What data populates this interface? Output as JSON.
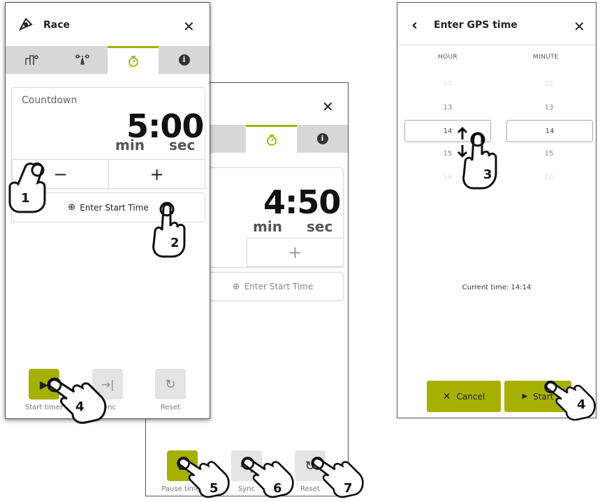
{
  "left_panel": {
    "title": "Race",
    "countdown_label": "Countdown",
    "time": "5:00",
    "unit_min": "min",
    "unit_sec": "sec",
    "minus": "−",
    "plus": "+",
    "enter_start_time": "Enter Start Time",
    "controls": [
      {
        "label": "Start timer",
        "icon": "play-icon",
        "active": true
      },
      {
        "label": "Sync",
        "icon": "sync-icon",
        "active": false
      },
      {
        "label": "Reset",
        "icon": "reset-icon",
        "active": false
      }
    ]
  },
  "middle_panel": {
    "time": "4:50",
    "unit_min": "min",
    "unit_sec": "sec",
    "plus": "+",
    "enter_start_time": "Enter Start Time",
    "controls": [
      {
        "label": "Pause timer",
        "icon": "pause-icon",
        "active": true
      },
      {
        "label": "Sync",
        "icon": "sync-icon",
        "active": false
      },
      {
        "label": "Reset",
        "icon": "reset-icon",
        "active": false
      }
    ]
  },
  "right_panel": {
    "title": "Enter GPS time",
    "hour_label": "HOUR",
    "minute_label": "MINUTE",
    "hours": [
      "12",
      "13",
      "14",
      "15",
      "16"
    ],
    "minutes": [
      "12",
      "13",
      "14",
      "15",
      "16"
    ],
    "selected_hour": "14",
    "selected_minute": "14",
    "current_time": "Current time: 14:14",
    "cancel": "Cancel",
    "start": "Start"
  },
  "step_numbers": [
    "1",
    "2",
    "3",
    "4",
    "4",
    "5",
    "6",
    "7"
  ],
  "colors": {
    "accent": "#a6b000",
    "tab_bar": "#d7d7d7"
  }
}
